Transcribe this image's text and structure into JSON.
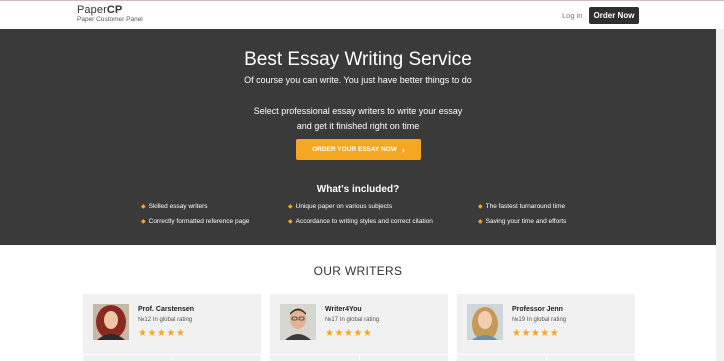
{
  "header": {
    "logo_bold": "CP",
    "logo_plain": "Paper",
    "logo_sub": "Paper Customer Panel",
    "login_label": "Log in",
    "order_label": "Order Now"
  },
  "hero": {
    "title": "Best Essay Writing Service",
    "subtitle": "Of course you can write. You just have better things to do",
    "line1": "Select professional essay writers to write your essay",
    "line2": "and get it finished right on time",
    "cta_label": "ORDER YOUR ESSAY NOW",
    "cta_arrow": "›",
    "included_title": "What's included?",
    "features": [
      "Skilled essay writers",
      "Unique paper on various subjects",
      "The fastest turnaround time",
      "Correctly formatted reference page",
      "Accordance to writing styles and correct citation",
      "Saving your time and efforts"
    ]
  },
  "writers": {
    "title": "OUR WRITERS",
    "cards": [
      {
        "name": "Prof. Carstensen",
        "rank": "№12 In global rating",
        "stars": "★★★★★"
      },
      {
        "name": "Writer4You",
        "rank": "№17 In global rating",
        "stars": "★★★★★"
      },
      {
        "name": "Professor Jenn",
        "rank": "№19 In global rating",
        "stars": "★★★★★"
      }
    ]
  },
  "colors": {
    "hero_bg": "#3a3a3a",
    "accent": "#f5a623",
    "button_dark": "#2f2f2f",
    "card_bg": "#f1f1f1"
  }
}
